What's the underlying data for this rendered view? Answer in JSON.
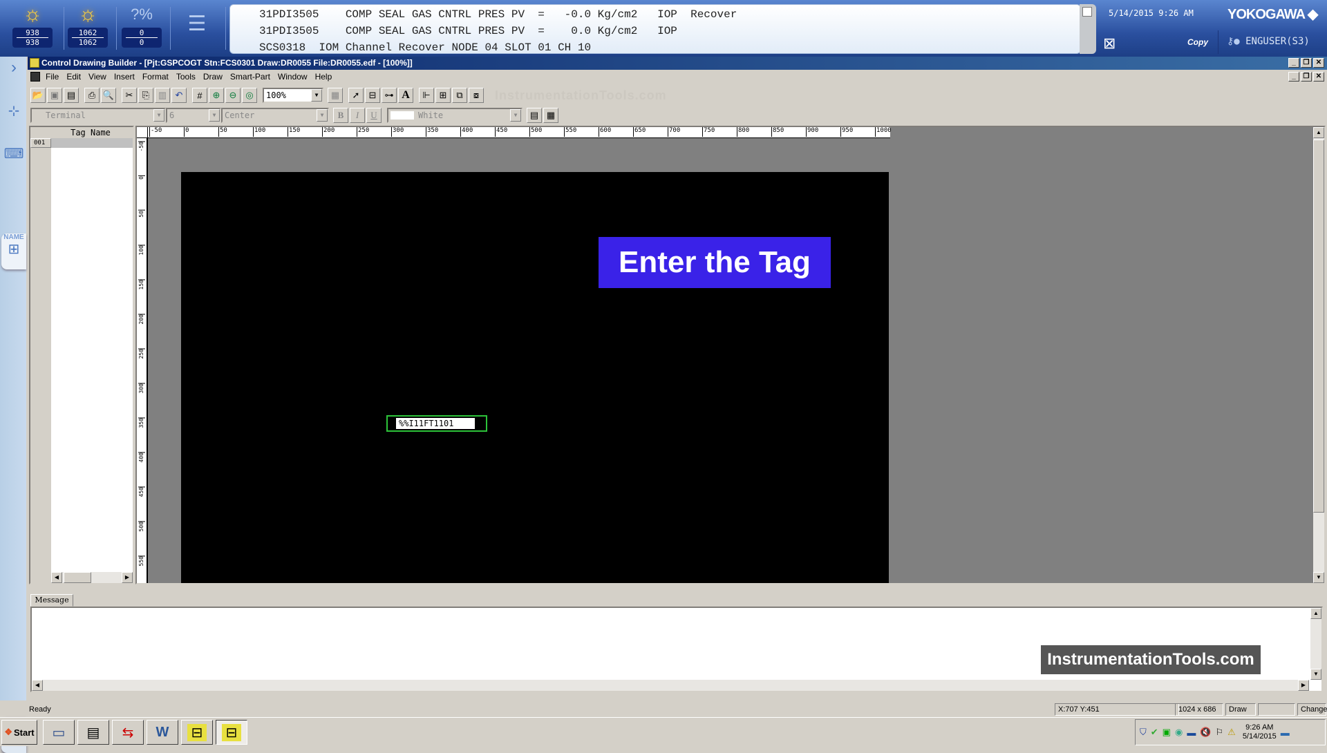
{
  "system_bar": {
    "process_alarm": {
      "top": "938",
      "bottom": "938"
    },
    "system_alarm": {
      "top": "1062",
      "bottom": "1062"
    },
    "operator_guide": {
      "top": "0",
      "bottom": "0"
    },
    "alarm_messages": [
      "31PDI3505    COMP SEAL GAS CNTRL PRES PV  =   -0.0 Kg/cm2   IOP  Recover",
      "31PDI3505    COMP SEAL GAS CNTRL PRES PV  =    0.0 Kg/cm2   IOP",
      "SCS0318  IOM Channel Recover NODE 04 SLOT 01 CH 10"
    ],
    "datetime": "5/14/2015 9:26 AM",
    "brand": "YOKOGAWA",
    "copy_label": "Copy",
    "user": "ENGUSER(S3)"
  },
  "side_nav": {
    "name_label": "NAME"
  },
  "window": {
    "title": "Control Drawing Builder - [Pjt:GSPCOGT Stn:FCS0301 Draw:DR0055 File:DR0055.edf -  [100%]]",
    "minimize": "_",
    "restore": "❐",
    "close": "✕"
  },
  "menu": [
    "File",
    "Edit",
    "View",
    "Insert",
    "Format",
    "Tools",
    "Draw",
    "Smart-Part",
    "Window",
    "Help"
  ],
  "toolbar": {
    "zoom_value": "100%",
    "watermark": "InstrumentationTools.com",
    "font_name": "Terminal",
    "font_size": "6",
    "alignment": "Center",
    "color": "White",
    "bold": "B",
    "italic": "I",
    "underline": "U"
  },
  "tag_panel": {
    "header": "Tag Name",
    "rows": [
      {
        "num": "001",
        "value": ""
      }
    ]
  },
  "ruler": {
    "h_ticks": [
      "-50",
      "0",
      "50",
      "100",
      "150",
      "200",
      "250",
      "300",
      "350",
      "400",
      "450",
      "500",
      "550",
      "600",
      "650",
      "700",
      "750",
      "800",
      "850",
      "900",
      "950",
      "1000"
    ],
    "v_ticks": [
      "-50",
      "0",
      "50",
      "100",
      "150",
      "200",
      "250",
      "300",
      "350",
      "400",
      "450",
      "500",
      "550"
    ]
  },
  "canvas": {
    "tag_object_text": "%%I11FT1101",
    "callout": "Enter the Tag"
  },
  "message_pane": {
    "tab_label": "Message",
    "watermark": "InstrumentationTools.com"
  },
  "status_bar": {
    "ready": "Ready",
    "coords": "X:707 Y:451",
    "size": "1024 x 686",
    "mode": "Draw",
    "blank": "",
    "change": "Change"
  },
  "taskbar": {
    "start": "Start",
    "clock_time": "9:26 AM",
    "clock_date": "5/14/2015"
  }
}
